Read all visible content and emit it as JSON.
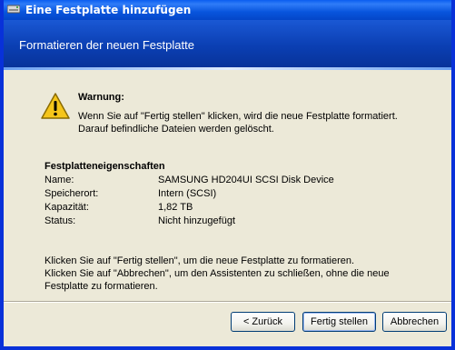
{
  "window": {
    "title": "Eine Festplatte hinzufügen"
  },
  "header": {
    "title": "Formatieren der neuen Festplatte"
  },
  "warning": {
    "title": "Warnung:",
    "line1": "Wenn Sie auf \"Fertig stellen\" klicken, wird die neue Festplatte formatiert.",
    "line2": "Darauf befindliche Dateien werden gelöscht."
  },
  "properties": {
    "title": "Festplatteneigenschaften",
    "rows": [
      {
        "label": "Name:",
        "value": "SAMSUNG HD204UI SCSI Disk Device"
      },
      {
        "label": "Speicherort:",
        "value": "Intern (SCSI)"
      },
      {
        "label": "Kapazität:",
        "value": "1,82 TB"
      },
      {
        "label": "Status:",
        "value": "Nicht hinzugefügt"
      }
    ]
  },
  "footer": {
    "line1": "Klicken Sie auf \"Fertig stellen\", um die neue Festplatte zu formatieren.",
    "line2": "Klicken Sie auf \"Abbrechen\", um den Assistenten zu schließen, ohne die neue",
    "line3": "Festplatte zu formatieren."
  },
  "buttons": {
    "back": "< Zurück",
    "finish": "Fertig stellen",
    "cancel": "Abbrechen"
  },
  "icons": {
    "title": "drive-icon",
    "warning": "warning-icon"
  },
  "colors": {
    "titlebar": "#0a5ef0",
    "header": "#0b3fb3",
    "dialog_bg": "#ece9d8"
  }
}
